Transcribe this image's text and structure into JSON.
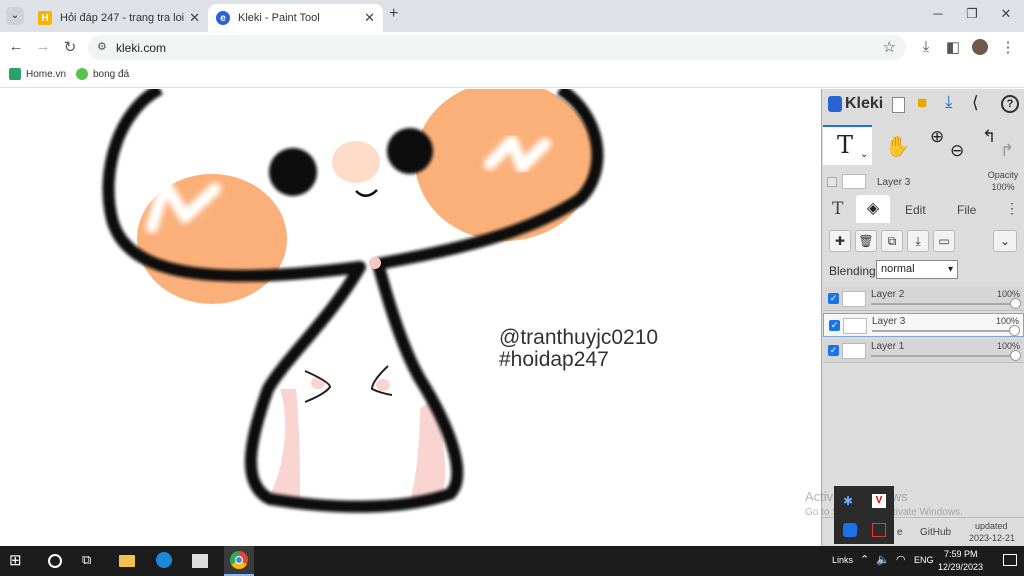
{
  "browser": {
    "tabs": [
      {
        "title": "Hỏi đáp 247 - trang tra loi",
        "active": false
      },
      {
        "title": "Kleki - Paint Tool",
        "active": true
      }
    ],
    "url": "kleki.com",
    "bookmarks": [
      {
        "label": "Home.vn"
      },
      {
        "label": "bong đá"
      }
    ]
  },
  "canvas": {
    "watermark_line1": "@tranthuyjc0210",
    "watermark_line2": "#hoidap247"
  },
  "kleki": {
    "logo": "Kleki",
    "current_layer_label": "Layer 3",
    "opacity_label": "Opacity",
    "opacity_value": "100%",
    "tabs": {
      "edit": "Edit",
      "file": "File"
    },
    "blending_label": "Blending",
    "blending_value": "normal",
    "layers": [
      {
        "name": "Layer 2",
        "opacity": "100%",
        "visible": true,
        "selected": false
      },
      {
        "name": "Layer 3",
        "opacity": "100%",
        "visible": true,
        "selected": true
      },
      {
        "name": "Layer 1",
        "opacity": "100%",
        "visible": true,
        "selected": false
      }
    ],
    "footer": {
      "github": "GitHub",
      "updated_label": "updated",
      "updated_date": "2023-12-21",
      "partial_left": "e"
    }
  },
  "windows": {
    "activate_title": "Activate Windows",
    "activate_sub": "Go to Settings to activate Windows.",
    "tray": {
      "links": "Links",
      "lang": "ENG",
      "time": "7:59 PM",
      "date": "12/29/2023"
    }
  }
}
